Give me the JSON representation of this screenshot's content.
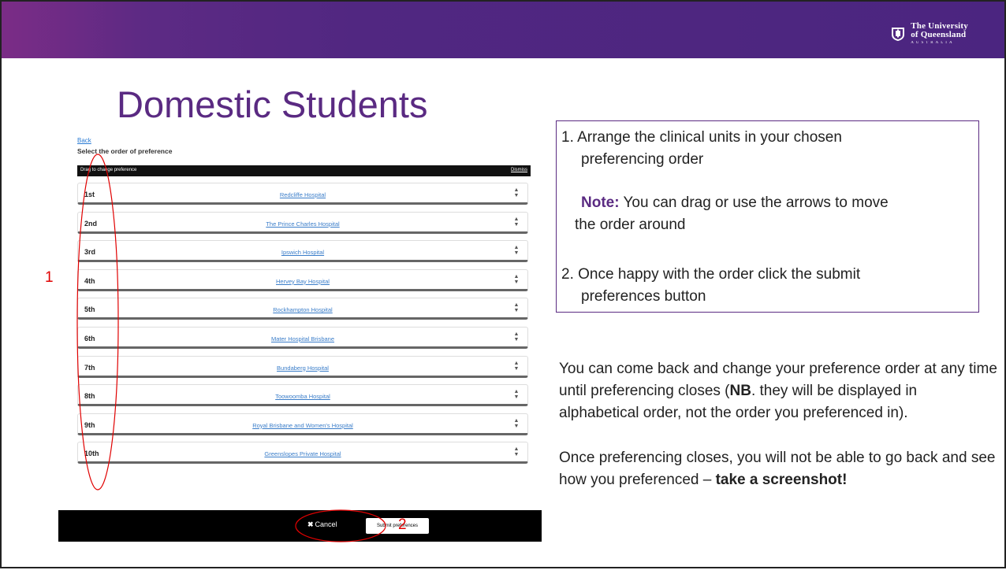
{
  "header": {
    "logo": {
      "line1": "The University",
      "line2": "of Queensland",
      "line3": "AUSTRALIA",
      "icon": "uq-crest-icon"
    },
    "colors": {
      "banner": "#512781",
      "title": "#5a2a82"
    }
  },
  "slide": {
    "title": "Domestic Students"
  },
  "screenshot": {
    "back_link": "Back",
    "heading": "Select the order of preference",
    "drag_bar": {
      "text": "Drag to change preference",
      "dismiss": "Dismiss"
    },
    "preferences": [
      {
        "rank": "1st",
        "hospital": "Redcliffe Hospital"
      },
      {
        "rank": "2nd",
        "hospital": "The Prince Charles Hospital"
      },
      {
        "rank": "3rd",
        "hospital": "Ipswich Hospital"
      },
      {
        "rank": "4th",
        "hospital": "Hervey Bay Hospital"
      },
      {
        "rank": "5th",
        "hospital": "Rockhampton Hospital"
      },
      {
        "rank": "6th",
        "hospital": "Mater Hospital Brisbane"
      },
      {
        "rank": "7th",
        "hospital": "Bundaberg Hospital"
      },
      {
        "rank": "8th",
        "hospital": "Toowoomba Hospital"
      },
      {
        "rank": "9th",
        "hospital": "Royal Brisbane and Women's Hospital"
      },
      {
        "rank": "10th",
        "hospital": "Greenslopes Private Hospital"
      }
    ],
    "arrow_icon": "sort-arrows-icon",
    "cancel_label": "Cancel",
    "cancel_icon": "close-icon",
    "submit_label": "Submit preferences"
  },
  "annotations": {
    "label1": "1",
    "label2": "2",
    "color": "#e00000"
  },
  "instructions": {
    "step1_line1": "1. Arrange the clinical units in your chosen",
    "step1_line2": "preferencing order",
    "note_label": "Note:",
    "note_line1": " You can drag or use the arrows to move",
    "note_line2": "the order around",
    "step2_line1": "2. Once happy with the order click the submit",
    "step2_line2": "preferences button"
  },
  "info": {
    "para1_before": "You can come back and change your preference order at any time until preferencing closes (",
    "para1_bold": "NB",
    "para1_after": ". they will be displayed in alphabetical order, not the order you preferenced in).",
    "para2_before": "Once preferencing closes, you will not be able to go back and see how you preferenced – ",
    "para2_bold": "take a screenshot!"
  }
}
